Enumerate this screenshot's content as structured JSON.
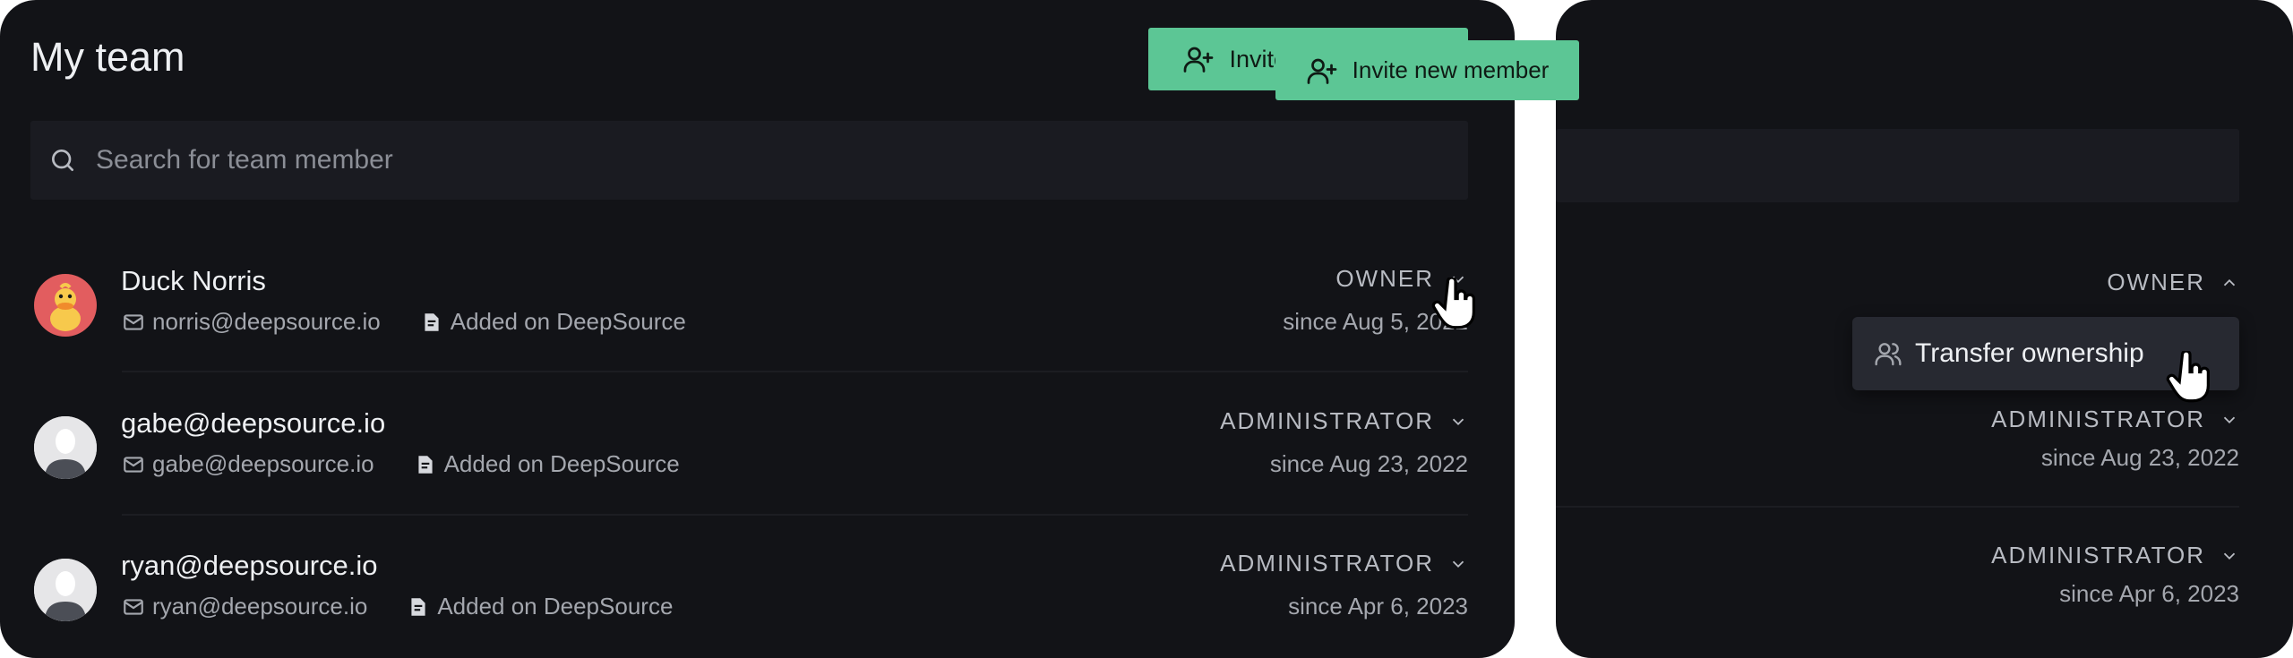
{
  "left": {
    "title": "My team",
    "invite_label": "Invite new member",
    "search_placeholder": "Search for team member",
    "members": [
      {
        "name": "Duck Norris",
        "email": "norris@deepsource.io",
        "source": "Added on DeepSource",
        "role": "OWNER",
        "since": "since Aug 5, 2022"
      },
      {
        "name": "gabe@deepsource.io",
        "email": "gabe@deepsource.io",
        "source": "Added on DeepSource",
        "role": "ADMINISTRATOR",
        "since": "since Aug 23, 2022"
      },
      {
        "name": "ryan@deepsource.io",
        "email": "ryan@deepsource.io",
        "source": "Added on DeepSource",
        "role": "ADMINISTRATOR",
        "since": "since Apr 6, 2023"
      }
    ]
  },
  "right": {
    "invite_label": "Invite new member",
    "owner_role": "OWNER",
    "dropdown_item": "Transfer ownership",
    "admin1_role": "ADMINISTRATOR",
    "admin1_since": "since Aug 23, 2022",
    "admin2_role": "ADMINISTRATOR",
    "admin2_since": "since Apr 6, 2023"
  },
  "colors": {
    "panel_bg": "#121317",
    "accent": "#5cc695",
    "text_primary": "#eef0f3",
    "text_secondary": "#a4a7ae"
  }
}
